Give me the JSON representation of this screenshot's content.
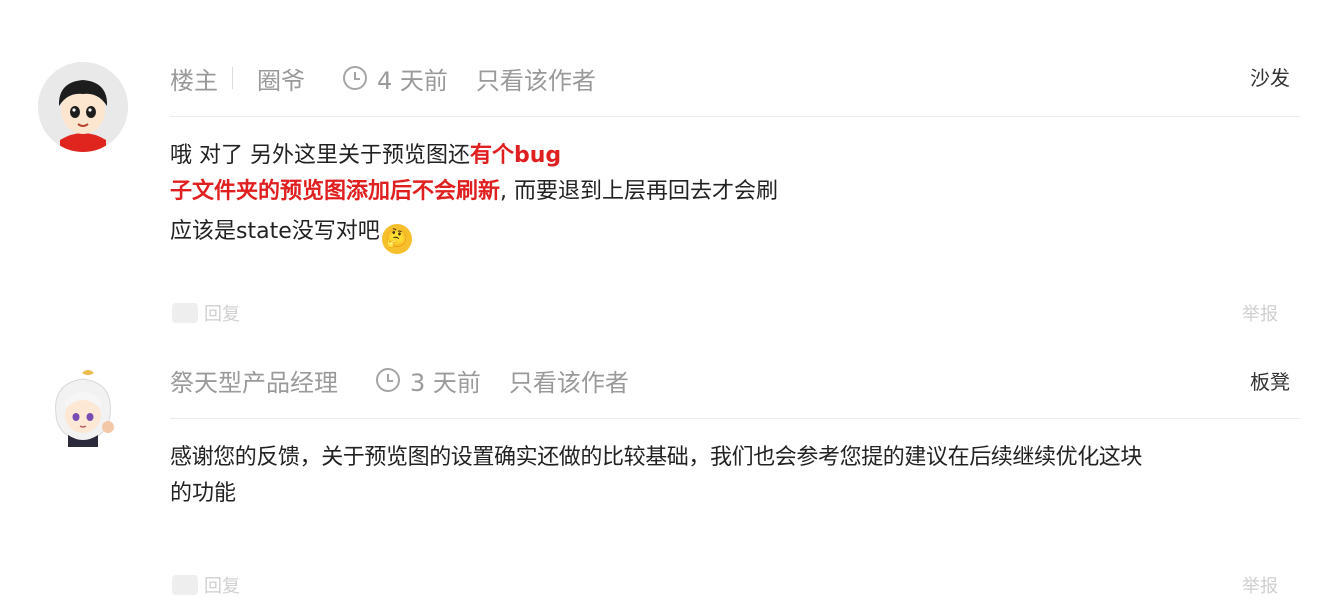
{
  "comments": [
    {
      "role_label": "楼主",
      "username": "圈爷",
      "time": "4 天前",
      "author_only": "只看该作者",
      "floor": "沙发",
      "body": {
        "line1_plain": "哦 对了 另外这里关于预览图还",
        "line1_highlight": "有个bug",
        "line2_highlight": "子文件夹的预览图添加后不会刷新",
        "line2_plain": ", 而要退到上层再回去才会刷",
        "line3_plain": "应该是state没写对吧"
      },
      "reply_label": "回复",
      "report_label": "举报",
      "avatar_icon": "cartoon-boy-avatar",
      "emoji_icon": "thinking-emoji"
    },
    {
      "username": "祭天型产品经理",
      "time": "3 天前",
      "author_only": "只看该作者",
      "floor": "板凳",
      "body_line1": "感谢您的反馈，关于预览图的设置确实还做的比较基础，我们也会参考您提的建议在后续继续优化这块",
      "body_line2": "的功能",
      "reply_label": "回复",
      "report_label": "举报",
      "avatar_icon": "anime-girl-avatar"
    }
  ],
  "colors": {
    "highlight": "#e02020",
    "meta_text": "#9a9a9a",
    "body_text": "#222222"
  }
}
